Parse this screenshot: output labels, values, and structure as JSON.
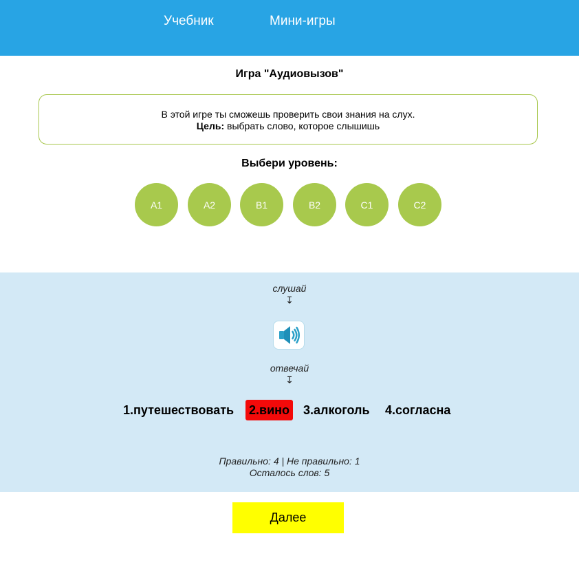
{
  "nav": {
    "textbook": "Учебник",
    "games": "Мини-игры"
  },
  "game": {
    "title": "Игра \"Аудиовызов\"",
    "description": "В этой игре ты сможешь проверить свои знания на слух.",
    "goal_label": "Цель:",
    "goal_text": "выбрать слово, которое слышишь"
  },
  "levels": {
    "title": "Выбери уровень:",
    "items": [
      "A1",
      "A2",
      "B1",
      "B2",
      "C1",
      "C2"
    ],
    "color": "#a8c94d"
  },
  "play": {
    "listen_hint": "слушай",
    "answer_hint": "отвечай",
    "arrow": "↧",
    "speaker_icon": "speaker-icon",
    "answers": [
      "1.путешествовать",
      "2.вино",
      "3.алкоголь",
      "4.согласна"
    ],
    "wrong_color": "#f30a0a",
    "stats_line1": "Правильно: 4 | Не правильно: 1",
    "stats_line2": "Осталось слов: 5"
  },
  "next_button": "Далее",
  "colors": {
    "header": "#28a4e4",
    "game_area": "#d3e9f6",
    "next_button": "#ffff00"
  }
}
